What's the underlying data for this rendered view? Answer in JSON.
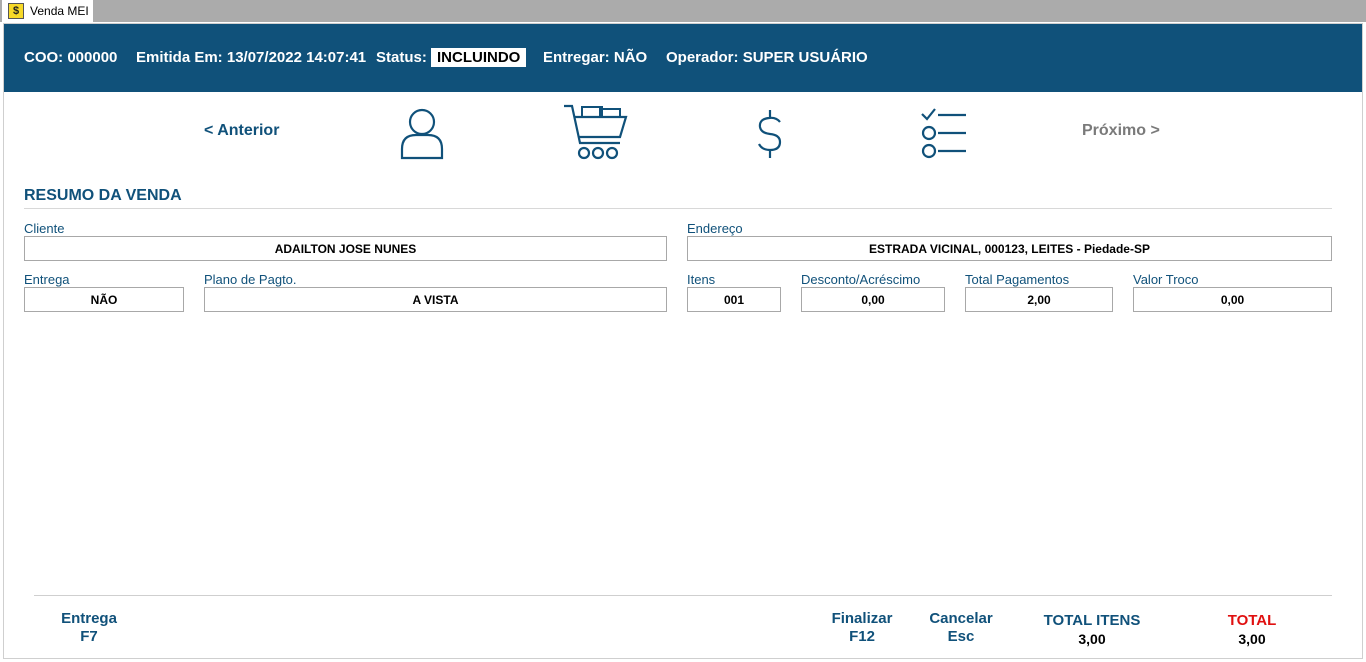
{
  "window": {
    "tab_title": "Venda MEI",
    "tab_icon": "app-icon"
  },
  "header": {
    "coo_label": "COO:",
    "coo_value": "000000",
    "emitida_label": "Emitida Em:",
    "emitida_value": "13/07/2022 14:07:41",
    "status_label": "Status:",
    "status_value": "INCLUINDO",
    "entregar_label": "Entregar:",
    "entregar_value": "NÃO",
    "operador_label": "Operador:",
    "operador_value": "SUPER USUÁRIO",
    "background_color": "#10517a"
  },
  "steps": {
    "prev_label": "< Anterior",
    "next_label": "Próximo >",
    "icons": [
      "user-icon",
      "shopping-cart-icon",
      "dollar-icon",
      "checklist-icon"
    ]
  },
  "summary": {
    "title": "RESUMO DA VENDA",
    "cliente_label": "Cliente",
    "cliente_value": "ADAILTON JOSE NUNES",
    "endereco_label": "Endereço",
    "endereco_value": "ESTRADA VICINAL, 000123, LEITES - Piedade-SP",
    "entrega_label": "Entrega",
    "entrega_value": "NÃO",
    "plano_label": "Plano de Pagto.",
    "plano_value": "A VISTA",
    "itens_label": "Itens",
    "itens_value": "001",
    "desconto_label": "Desconto/Acréscimo",
    "desconto_value": "0,00",
    "total_pag_label": "Total Pagamentos",
    "total_pag_value": "2,00",
    "troco_label": "Valor Troco",
    "troco_value": "0,00"
  },
  "footer": {
    "entrega_label": "Entrega",
    "entrega_key": "F7",
    "finalizar_label": "Finalizar",
    "finalizar_key": "F12",
    "cancelar_label": "Cancelar",
    "cancelar_key": "Esc",
    "total_itens_label": "TOTAL ITENS",
    "total_itens_value": "3,00",
    "total_label": "TOTAL",
    "total_value": "3,00",
    "total_color": "#e01010"
  }
}
